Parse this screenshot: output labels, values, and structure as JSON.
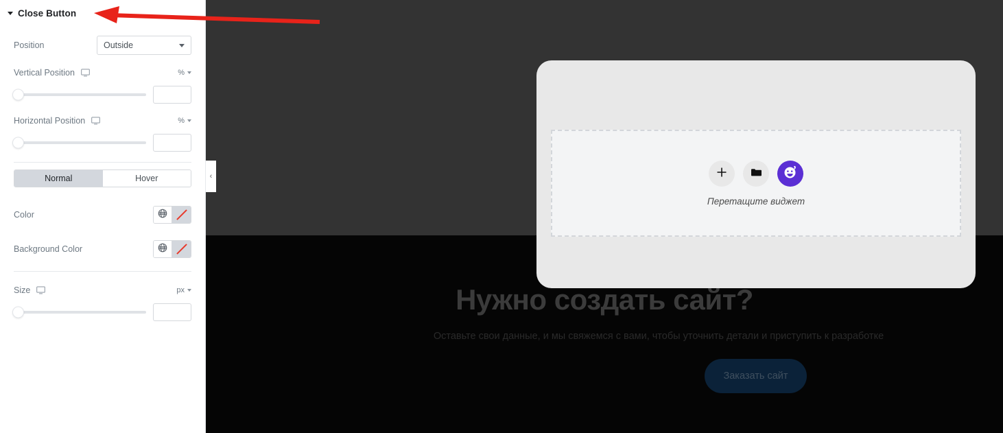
{
  "panel": {
    "title": "Close Button",
    "collapse_caret_icon": "caret-down-icon",
    "position": {
      "label": "Position",
      "value": "Outside"
    },
    "vertical_position": {
      "label": "Vertical Position",
      "device_icon": "desktop-icon",
      "unit": "%",
      "value": ""
    },
    "horizontal_position": {
      "label": "Horizontal Position",
      "device_icon": "desktop-icon",
      "unit": "%",
      "value": ""
    },
    "state_tabs": {
      "normal": "Normal",
      "hover": "Hover",
      "active": "Normal"
    },
    "color": {
      "label": "Color",
      "globe_icon": "globe-icon",
      "none_icon": "no-color-icon"
    },
    "background_color": {
      "label": "Background Color",
      "globe_icon": "globe-icon",
      "none_icon": "no-color-icon"
    },
    "size": {
      "label": "Size",
      "device_icon": "desktop-icon",
      "unit": "px",
      "value": ""
    }
  },
  "collapse_handle": {
    "icon": "chevron-left-icon",
    "glyph": "‹"
  },
  "modal": {
    "dropzone": {
      "label": "Перетащите виджет",
      "buttons": [
        {
          "name": "add-widget-button",
          "icon": "plus-icon",
          "glyph": "+"
        },
        {
          "name": "open-folder-button",
          "icon": "folder-icon",
          "glyph": ""
        },
        {
          "name": "ai-assistant-button",
          "icon": "ai-face-icon",
          "glyph": ""
        }
      ]
    }
  },
  "hero": {
    "title": "Нужно создать сайт?",
    "subtitle": "Оставьте свои данные, и мы свяжемся с вами, чтобы уточнить детали и приступить к разработке",
    "cta": "Заказать сайт"
  },
  "annotation": {
    "arrow_icon": "red-arrow-left",
    "color": "#e8231a"
  },
  "colors": {
    "accent_purple": "#5b2fd4",
    "canvas_top": "#333333",
    "canvas_bottom": "#050505",
    "modal_bg": "#e8e8e8",
    "cta_bg": "#0b2239"
  }
}
